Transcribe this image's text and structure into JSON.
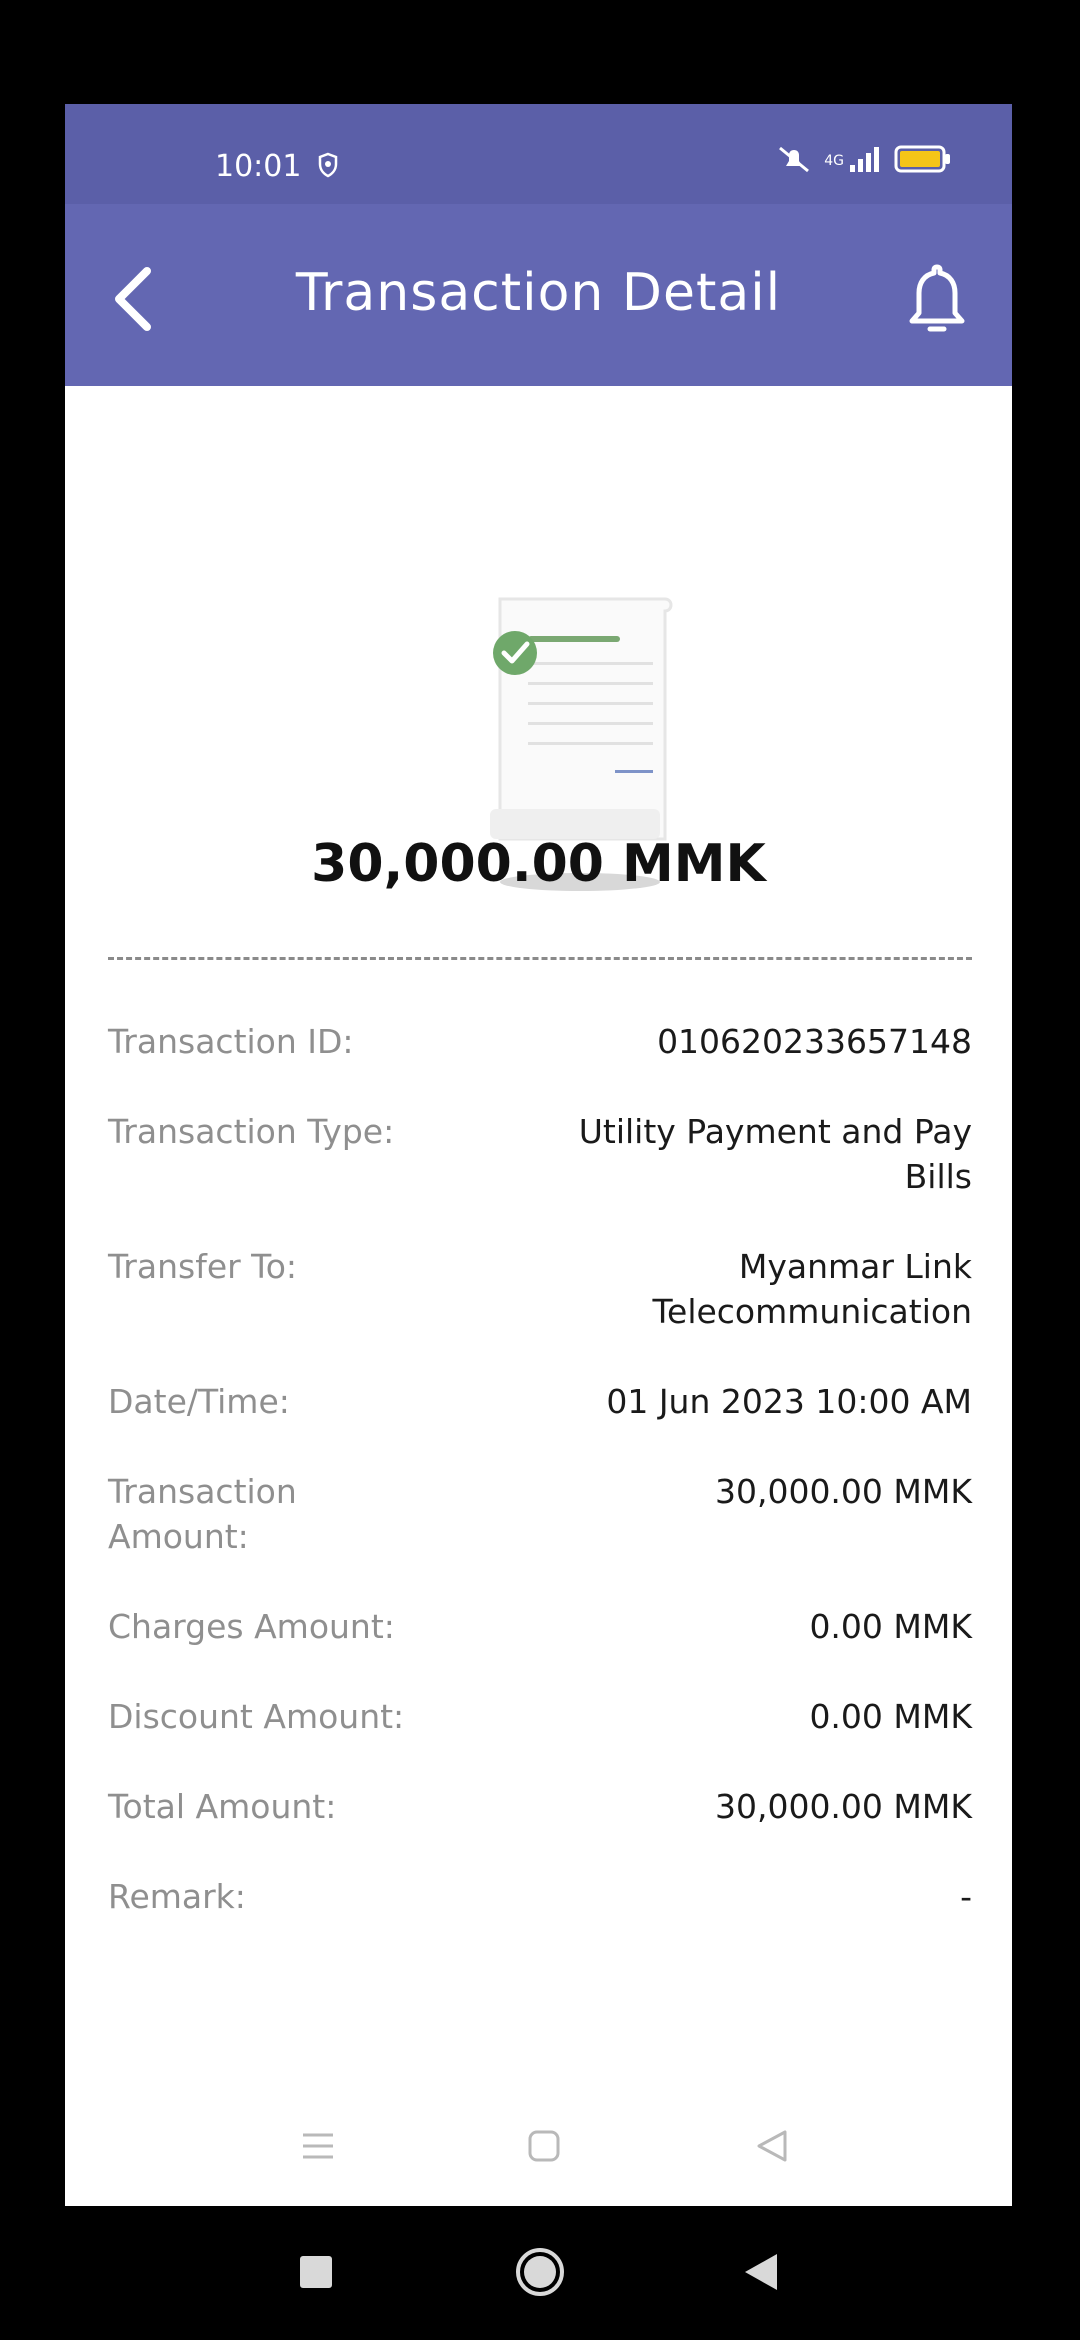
{
  "status_bar": {
    "time": "10:01",
    "network": "4G"
  },
  "header": {
    "title": "Transaction Detail",
    "back_icon": "chevron-left-icon",
    "notification_icon": "bell-icon"
  },
  "receipt": {
    "amount": "30,000.00 MMK"
  },
  "details": [
    {
      "label": "Transaction ID:",
      "value": "010620233657148"
    },
    {
      "label": "Transaction Type:",
      "value": "Utility Payment and Pay Bills"
    },
    {
      "label": "Transfer To:",
      "value": "Myanmar Link Telecommunication"
    },
    {
      "label": "Date/Time:",
      "value": "01 Jun 2023 10:00 AM"
    },
    {
      "label": "Transaction Amount:",
      "value": "30,000.00 MMK"
    },
    {
      "label": "Charges Amount:",
      "value": "0.00 MMK"
    },
    {
      "label": "Discount Amount:",
      "value": "0.00 MMK"
    },
    {
      "label": "Total Amount:",
      "value": "30,000.00 MMK"
    },
    {
      "label": "Remark:",
      "value": "-"
    }
  ],
  "colors": {
    "header": "#6367b2",
    "status_bar": "#5b5fa8",
    "success": "#6fa86a"
  }
}
